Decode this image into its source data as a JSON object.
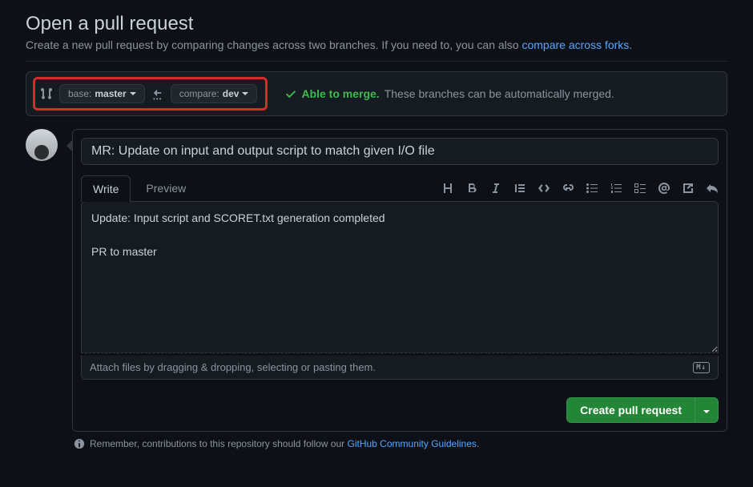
{
  "header": {
    "title": "Open a pull request",
    "subtitle_before": "Create a new pull request by comparing changes across two branches. If you need to, you can also ",
    "subtitle_link": "compare across forks",
    "subtitle_after": "."
  },
  "branches": {
    "base_label": "base:",
    "base_value": "master",
    "compare_label": "compare:",
    "compare_value": "dev"
  },
  "merge": {
    "status": "Able to merge.",
    "message": "These branches can be automatically merged."
  },
  "compose": {
    "title_value": "MR: Update on input and output script to match given I/O file",
    "body_value": "Update: Input script and SCORET.txt generation completed\n\nPR to master",
    "tab_write": "Write",
    "tab_preview": "Preview",
    "attach_hint": "Attach files by dragging & dropping, selecting or pasting them."
  },
  "actions": {
    "submit": "Create pull request"
  },
  "footer": {
    "before": "Remember, contributions to this repository should follow our ",
    "link": "GitHub Community Guidelines",
    "after": "."
  }
}
